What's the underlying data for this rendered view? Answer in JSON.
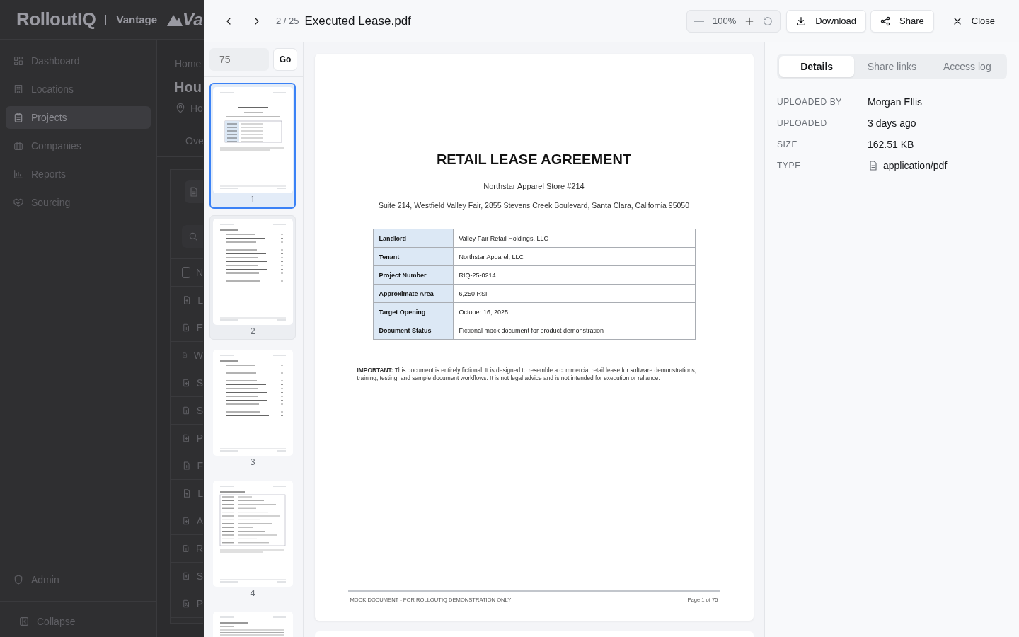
{
  "app": {
    "logo": "RolloutIQ",
    "product": "Vantage",
    "partner_logo": "Va",
    "sidebar": {
      "items": [
        {
          "label": "Dashboard",
          "selected": false
        },
        {
          "label": "Locations",
          "selected": false
        },
        {
          "label": "Projects",
          "selected": true
        },
        {
          "label": "Companies",
          "selected": false
        },
        {
          "label": "Reports",
          "selected": false
        },
        {
          "label": "Sourcing",
          "selected": false
        }
      ],
      "footer_items": [
        {
          "label": "Admin"
        },
        {
          "label": "Collapse"
        }
      ]
    },
    "breadcrumb": "Home",
    "title": "Hou",
    "location": "Ho",
    "tab": "Ove",
    "table": {
      "header": "N",
      "header_checked": false,
      "rows": [
        {
          "text": "L",
          "kind": "document"
        },
        {
          "text": "E",
          "kind": "document"
        },
        {
          "text": "W",
          "kind": "document"
        },
        {
          "text": "S",
          "kind": "document"
        },
        {
          "text": "S",
          "kind": "document"
        },
        {
          "text": "P",
          "kind": "document"
        },
        {
          "text": "F",
          "kind": "document"
        },
        {
          "text": "L",
          "kind": "document"
        },
        {
          "text": "A",
          "kind": "document"
        },
        {
          "text": "R",
          "kind": "document"
        },
        {
          "text": "S",
          "kind": "image"
        },
        {
          "text": "P",
          "kind": "image"
        }
      ]
    }
  },
  "viewer": {
    "counter": "2 / 25",
    "filename": "Executed Lease.pdf",
    "zoom": "100%",
    "actions": [
      {
        "label": "Download"
      },
      {
        "label": "Share"
      },
      {
        "label": "Close"
      }
    ],
    "page_jump": {
      "placeholder": "75",
      "button": "Go"
    },
    "thumbnails": [
      {
        "number": "1",
        "kind": "cover",
        "selected": true
      },
      {
        "number": "2",
        "kind": "toc",
        "selected": false
      },
      {
        "number": "3",
        "kind": "toc",
        "selected": false
      },
      {
        "number": "4",
        "kind": "table",
        "selected": false
      },
      {
        "kind": "text",
        "selected": false
      }
    ],
    "document": {
      "title": "RETAIL LEASE AGREEMENT",
      "subtitle": "Northstar Apparel Store #214",
      "address": "Suite 214, Westfield Valley Fair, 2855 Stevens Creek Boulevard, Santa Clara, California 95050",
      "table": [
        {
          "label": "Landlord",
          "value": "Valley Fair Retail Holdings, LLC"
        },
        {
          "label": "Tenant",
          "value": "Northstar Apparel, LLC"
        },
        {
          "label": "Project Number",
          "value": "RIQ-25-0214"
        },
        {
          "label": "Approximate Area",
          "value": "6,250 RSF"
        },
        {
          "label": "Target Opening",
          "value": "October 16, 2025"
        },
        {
          "label": "Document Status",
          "value": "Fictional mock document for product demonstration"
        }
      ],
      "notice": "**IMPORTANT:** This document is entirely fictional. It is designed to resemble a commercial retail lease for software demonstrations, training, testing, and sample document workflows. It is not legal advice and is not intended for execution or reliance.",
      "footer_left": "MOCK DOCUMENT - FOR ROLLOUTIQ DEMONSTRATION ONLY",
      "footer_right": "Page 1 of 75"
    },
    "panel": {
      "tabs": [
        {
          "label": "Details",
          "selected": true
        },
        {
          "label": "Share links",
          "selected": false
        },
        {
          "label": "Access log",
          "selected": false
        }
      ],
      "details": [
        {
          "label": "UPLOADED BY",
          "value": "Morgan Ellis",
          "kind": "text"
        },
        {
          "label": "UPLOADED",
          "value": "3 days ago",
          "kind": "text"
        },
        {
          "label": "SIZE",
          "value": "162.51 KB",
          "kind": "text"
        },
        {
          "label": "TYPE",
          "value": "application/pdf",
          "kind": "file"
        }
      ]
    }
  }
}
